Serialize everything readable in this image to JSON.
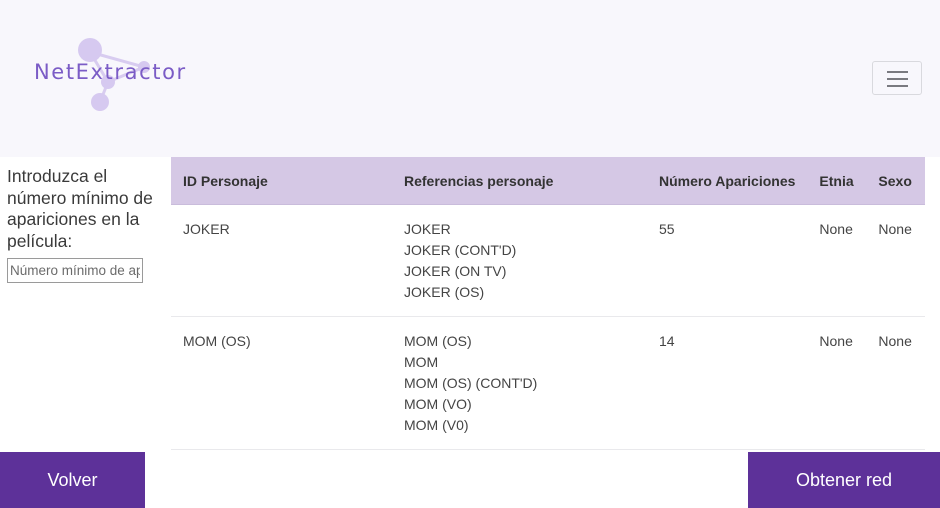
{
  "brand": {
    "name": "NetExtractor",
    "colors": {
      "primary": "#5d3199",
      "accent": "#7b5cc6",
      "table_header": "#d5c8e5"
    }
  },
  "nav": {
    "menu_icon": "hamburger-icon"
  },
  "sidebar": {
    "label": "Introduzca el número mínimo de apariciones en la película:",
    "input_placeholder": "Número mínimo de apariciones",
    "input_value": ""
  },
  "table": {
    "headers": [
      "ID Personaje",
      "Referencias personaje",
      "Número Apariciones",
      "Etnia",
      "Sexo"
    ],
    "rows": [
      {
        "id": "JOKER",
        "refs": [
          "JOKER",
          "JOKER (CONT'D)",
          "JOKER (ON TV)",
          "JOKER (OS)"
        ],
        "count": "55",
        "etnia": "None",
        "sexo": "None"
      },
      {
        "id": "MOM (OS)",
        "refs": [
          "MOM (OS)",
          "MOM",
          "MOM (OS) (CONT'D)",
          "MOM (VO)",
          "MOM (V0)"
        ],
        "count": "14",
        "etnia": "None",
        "sexo": "None"
      }
    ]
  },
  "buttons": {
    "back": "Volver",
    "get_network": "Obtener red"
  }
}
